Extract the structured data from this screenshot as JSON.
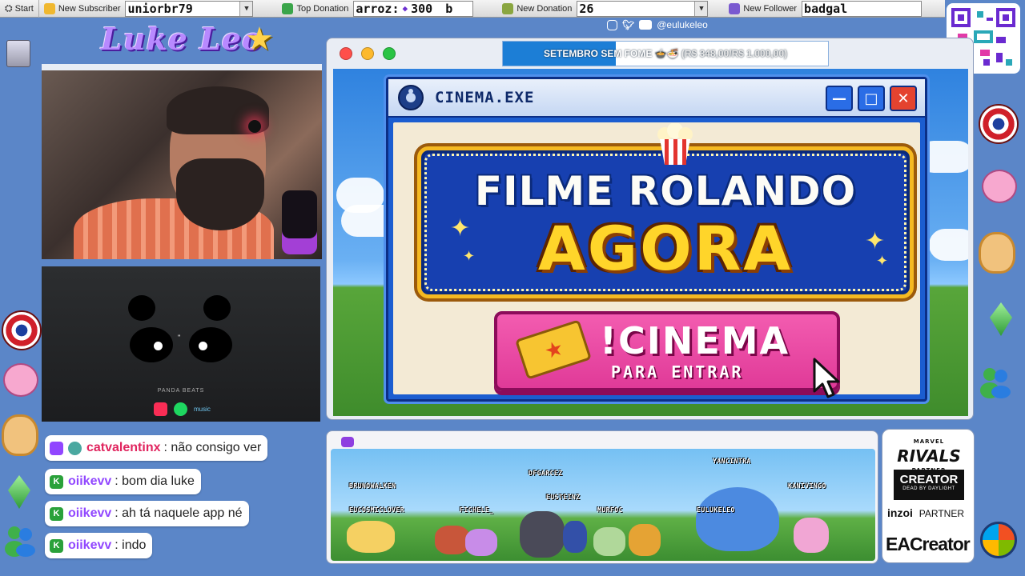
{
  "taskbar": {
    "start_label": "Start",
    "subscriber_label": "New Subscriber",
    "subscriber_value": "uniorbr79",
    "donation_label": "Top Donation",
    "top_donation_name": "arroz:",
    "top_donation_amount": "300",
    "top_donation_suffix": "b",
    "new_donation_label": "New Donation",
    "new_donation_value": "26",
    "new_follower_label": "New Follower",
    "new_follower_value": "badgal"
  },
  "logo": {
    "text": "Luke Leo"
  },
  "social": {
    "handle": "@eulukeleo"
  },
  "donation_goal": {
    "title": "SETEMBRO SEM FOME",
    "emoji": "🍲🍜",
    "progress_text": "(R$ 348,00/R$ 1.000,00)",
    "progress_fraction": 0.348
  },
  "panda": {
    "label": "PANDA BEATS",
    "music_label": "music"
  },
  "cinema": {
    "title": "CINEMA.EXE",
    "buttons": {
      "minimize": "—",
      "maximize": "□",
      "close": "✕"
    },
    "line1": "FILME ROLANDO",
    "line2": "AGORA",
    "cta_command": "!CINEMA",
    "cta_sub": "PARA ENTRAR"
  },
  "chat": [
    {
      "user": "catvalentinx",
      "message": ": não consigo ver",
      "color": "#e0245e",
      "badge": "twitch"
    },
    {
      "user": "oiikevv",
      "message": ": bom dia luke",
      "color": "#9147ff",
      "badge": "kick"
    },
    {
      "user": "oiikevv",
      "message": ": ah tá naquele app né",
      "color": "#9147ff",
      "badge": "kick"
    },
    {
      "user": "oiikevv",
      "message": ": indo",
      "color": "#9147ff",
      "badge": "kick"
    }
  ],
  "community": {
    "names": [
      "BRUNOWALKEN",
      "EUCOSMICLOVER",
      "FICHELE_",
      "DFGARCEZ",
      "EUSTEINZ",
      "MURFOC",
      "EULUKELEO",
      "YANCINTRA",
      "KANIVINGO"
    ]
  },
  "partners": {
    "rivals_brand": "MARVEL",
    "rivals": "RIVALS",
    "rivals_sub": "PARTNER",
    "creator": "CREATOR",
    "creator_sub": "DEAD BY DAYLIGHT",
    "inzoi": "inzoi",
    "inzoi_sub": "PARTNER",
    "ea": "EACreator"
  },
  "colors": {
    "background": "#5b86c8",
    "accent_pink": "#e03a98",
    "accent_yellow": "#ffd52a",
    "dialog_blue": "#1b5dd0"
  }
}
